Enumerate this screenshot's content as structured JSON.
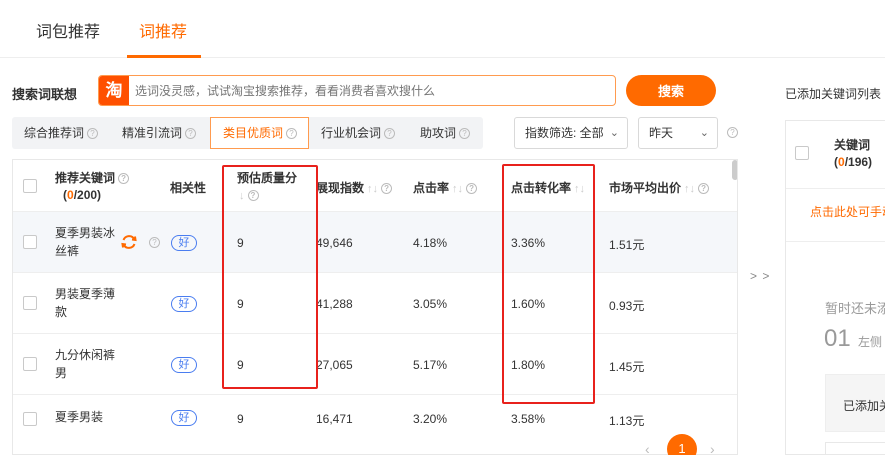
{
  "top_tabs": [
    {
      "label": "词包推荐",
      "active": false
    },
    {
      "label": "词推荐",
      "active": true
    }
  ],
  "search": {
    "label": "搜索词联想",
    "logo_text": "淘",
    "placeholder": "选词没灵感，试试淘宝搜索推荐，看看消费者喜欢搜什么",
    "button": "搜索"
  },
  "added_list_title": "已添加关键词列表",
  "filter_tabs": [
    {
      "label": "综合推荐词",
      "active": false
    },
    {
      "label": "精准引流词",
      "active": false
    },
    {
      "label": "类目优质词",
      "active": true
    },
    {
      "label": "行业机会词",
      "active": false
    },
    {
      "label": "助攻词",
      "active": false
    }
  ],
  "index_filter": "指数筛选: 全部",
  "date_filter": "昨天",
  "table": {
    "headers": {
      "keyword": "推荐关键词",
      "count_current": "0",
      "count_total": "/200",
      "relevance": "相关性",
      "quality_score": "预估质量分",
      "impressions": "展现指数",
      "ctr": "点击率",
      "cvr": "点击转化率",
      "avg_bid": "市场平均出价"
    },
    "rows": [
      {
        "keyword": "夏季男装冰丝裤",
        "relevance": "好",
        "quality_score": "9",
        "impressions": "49,646",
        "ctr": "4.18%",
        "cvr": "3.36%",
        "avg_bid": "1.51元"
      },
      {
        "keyword": "男装夏季薄款",
        "relevance": "好",
        "quality_score": "9",
        "impressions": "41,288",
        "ctr": "3.05%",
        "cvr": "1.60%",
        "avg_bid": "0.93元"
      },
      {
        "keyword": "九分休闲裤男",
        "relevance": "好",
        "quality_score": "9",
        "impressions": "27,065",
        "ctr": "5.17%",
        "cvr": "1.80%",
        "avg_bid": "1.45元"
      },
      {
        "keyword": "夏季男装",
        "relevance": "好",
        "quality_score": "9",
        "impressions": "16,471",
        "ctr": "3.20%",
        "cvr": "3.58%",
        "avg_bid": "1.13元"
      }
    ]
  },
  "transfer_arrow": "> >",
  "right_panel": {
    "header_label": "关键词",
    "count_current": "0",
    "count_total": "/196",
    "hint": "点击此处可手动",
    "empty_text": "暂时还未添",
    "step_number": "01",
    "step_text": "左侧",
    "box_text": "已添加关"
  },
  "pagination": {
    "prev": "‹",
    "current": "1",
    "next": "›"
  },
  "colors": {
    "accent": "#ff6a00",
    "highlight_border": "#e8211c",
    "badge_blue": "#4a7df0"
  }
}
